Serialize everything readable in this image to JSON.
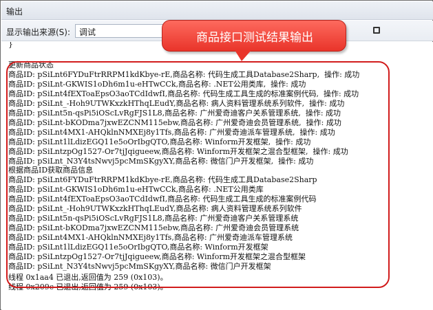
{
  "panel": {
    "title": "输出"
  },
  "toolbar": {
    "source_label": "显示输出来源(S):",
    "source_value": "调试"
  },
  "callout": {
    "text": "商品接口测试结果输出"
  },
  "output_lines": [
    "}",
    "",
    "",
    "更新商品状态",
    "商品ID: pSiLnt6FYDuFtrRRPM1kdKbye-rE,商品名称: 代码生成工具Database2Sharp,  操作: 成功",
    "商品ID: pSiLnt-GKWIS1oDh6m1u-eHTwCCk,商品名称: .NET公用类库,  操作: 成功",
    "商品ID: pSiLnt4fEXToaEpsO3aoTCdIdwfI,商品名称: 代码生成工具生成的标准案例代码,  操作: 成功",
    "商品ID: pSiLnt_-Hoh9UTWKxzkHThqLEudY,商品名称: 病人资料管理系统系列软件,  操作: 成功",
    "商品ID: pSiLnt5n-qsPi5iOScLvRgFJS1L8,商品名称: 广州爱奇迪客户关系管理系统,  操作: 成功",
    "商品ID: pSiLnt-bKODma7jxwEZCNM115ebw,商品名称: 广州爱奇迪会员管理系统,  操作: 成功",
    "商品ID: pSiLnt4MX1-AHQklnNMXEj8y1Tfs,商品名称: 广州爱奇迪派车管理系统,  操作: 成功",
    "商品ID: pSiLnt1lLdizEGQ11e5oOrIbgQTO,商品名称: Winform开发框架,  操作: 成功",
    "商品ID: pSiLntzpOg1527-Or7tjJqigueew,商品名称: Winform开发框架之混合型框架,  操作: 成功",
    "商品ID: pSiLnt_N3Y4tsNwvj5pcMmSKgyXY,商品名称: 微信门户开发框架,  操作: 成功",
    "根据商品ID获取商品信息",
    "商品ID: pSiLnt6FYDuFtrRRPM1kdKbye-rE,商品名称: 代码生成工具Database2Sharp",
    "商品ID: pSiLnt-GKWIS1oDh6m1u-eHTwCCk,商品名称: .NET公用类库",
    "商品ID: pSiLnt4fEXToaEpsO3aoTCdIdwfI,商品名称: 代码生成工具生成的标准案例代码",
    "商品ID: pSiLnt_-Hoh9UTWKxzkHThqLEudY,商品名称: 病人资料管理系统系列软件",
    "商品ID: pSiLnt5n-qsPi5iOScLvRgFJS1L8,商品名称: 广州爱奇迪客户关系管理系统",
    "商品ID: pSiLnt-bKODma7jxwEZCNM115ebw,商品名称: 广州爱奇迪会员管理系统",
    "商品ID: pSiLnt4MX1-AHQklnNMXEj8y1Tfs,商品名称: 广州爱奇迪派车管理系统",
    "商品ID: pSiLnt1lLdizEGQ11e5oOrIbgQTO,商品名称: Winform开发框架",
    "商品ID: pSiLntzpOg1527-Or7tjJqigueew,商品名称: Winform开发框架之混合型框架",
    "商品ID: pSiLnt_N3Y4tsNwvj5pcMmSKgyXY,商品名称: 微信门户开发框架",
    "线程 0x1aa4 已退出,返回值为 259 (0x103)。",
    "线程 0x209c 已退出,返回值为 259 (0x103)。"
  ]
}
